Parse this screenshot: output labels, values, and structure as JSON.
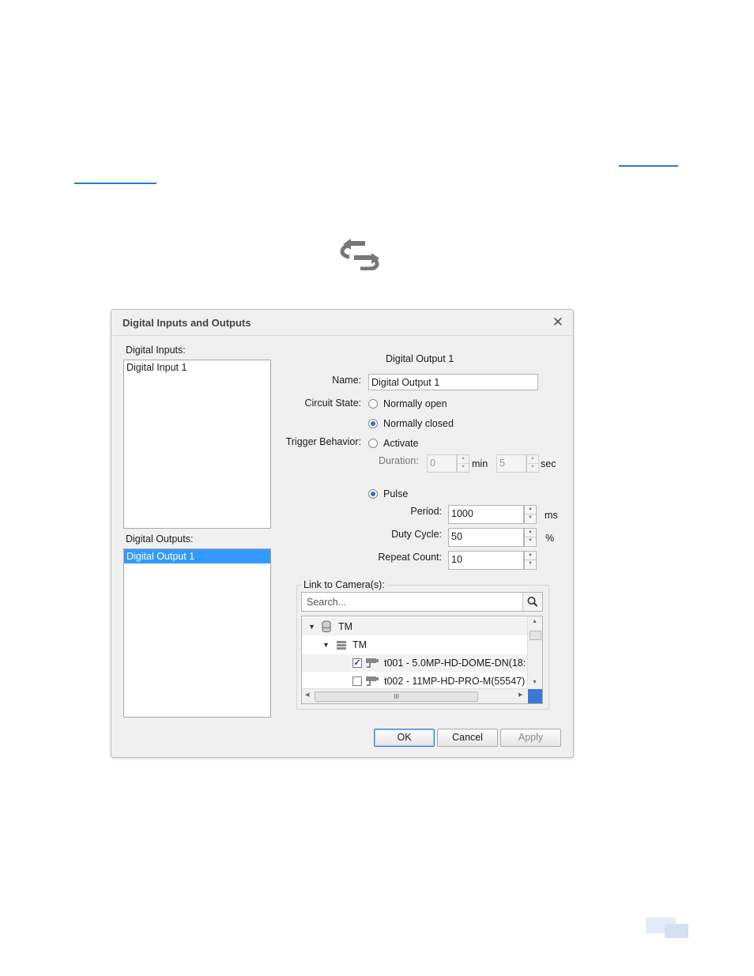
{
  "page": {
    "icon": "digital-io-swap-icon",
    "link_color": "#2a7bd1"
  },
  "dialog": {
    "title": "Digital Inputs and Outputs",
    "close_glyph": "✕",
    "inputs_label": "Digital Inputs:",
    "inputs": [
      "Digital Input 1"
    ],
    "outputs_label": "Digital Outputs:",
    "outputs": [
      "Digital Output 1"
    ],
    "selected_output": "Digital Output 1",
    "heading": "Digital Output 1",
    "name_label": "Name:",
    "name_value": "Digital Output 1",
    "circuit_state_label": "Circuit State:",
    "circuit_normally_open": "Normally open",
    "circuit_normally_closed": "Normally closed",
    "circuit_selected": "Normally closed",
    "trigger_behavior_label": "Trigger Behavior:",
    "trigger_activate": "Activate",
    "duration_label": "Duration:",
    "duration_min_value": "0",
    "duration_min_unit": "min",
    "duration_sec_value": "5",
    "duration_sec_unit": "sec",
    "trigger_pulse": "Pulse",
    "trigger_selected": "Pulse",
    "period_label": "Period:",
    "period_value": "1000",
    "period_unit": "ms",
    "duty_cycle_label": "Duty Cycle:",
    "duty_cycle_value": "50",
    "duty_cycle_unit": "%",
    "repeat_count_label": "Repeat Count:",
    "repeat_count_value": "10",
    "link_label": "Link to Camera(s):",
    "search_placeholder": "Search...",
    "tree": {
      "site": "TM",
      "server": "TM",
      "cameras": [
        {
          "label": "t001 - 5.0MP-HD-DOME-DN(18:",
          "checked": true
        },
        {
          "label": "t002 - 11MP-HD-PRO-M(55547)",
          "checked": false
        }
      ]
    },
    "hscroll_grip": "III",
    "buttons": {
      "ok": "OK",
      "cancel": "Cancel",
      "apply": "Apply"
    }
  }
}
